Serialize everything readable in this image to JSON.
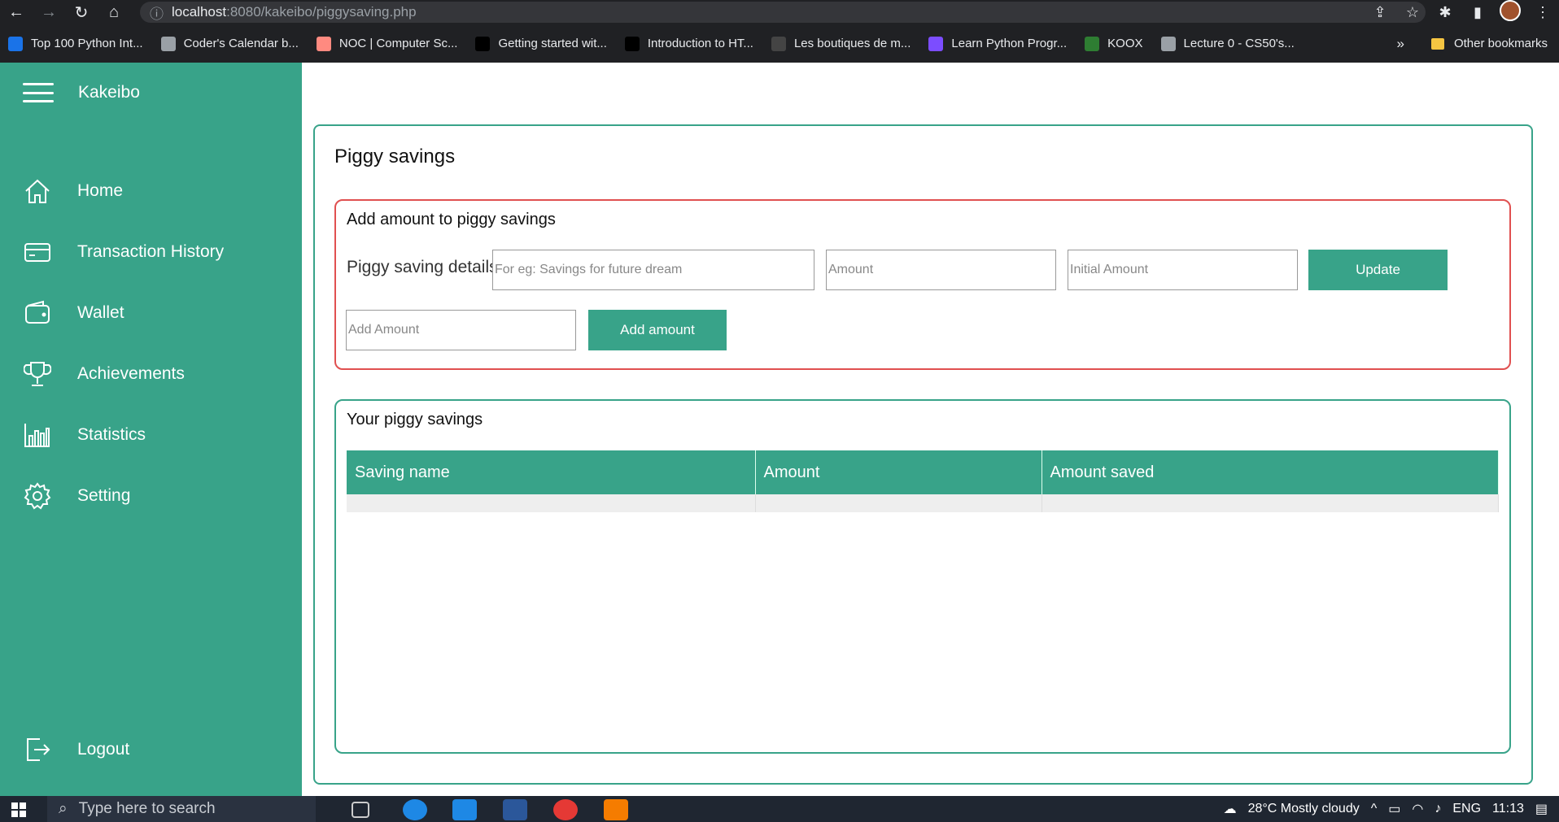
{
  "browser": {
    "url_host": "localhost",
    "url_path": ":8080/kakeibo/piggysaving.php",
    "bookmarks": [
      {
        "label": "Top 100 Python Int...",
        "color": "#1a73e8"
      },
      {
        "label": "Coder's Calendar b...",
        "color": "#9aa0a6"
      },
      {
        "label": "NOC | Computer Sc...",
        "color": "#ff8a80"
      },
      {
        "label": "Getting started wit...",
        "color": "#000000"
      },
      {
        "label": "Introduction to HT...",
        "color": "#000000"
      },
      {
        "label": "Les boutiques de m...",
        "color": "#444444"
      },
      {
        "label": "Learn Python Progr...",
        "color": "#7c4dff"
      },
      {
        "label": "KOOX",
        "color": "#2e7d32"
      },
      {
        "label": "Lecture 0 - CS50's...",
        "color": "#9aa0a6"
      }
    ],
    "more": "»",
    "other_bookmarks": "Other bookmarks"
  },
  "sidebar": {
    "brand": "Kakeibo",
    "items": [
      {
        "label": "Home",
        "icon": "home-icon"
      },
      {
        "label": "Transaction History",
        "icon": "card-icon"
      },
      {
        "label": "Wallet",
        "icon": "wallet-icon"
      },
      {
        "label": "Achievements",
        "icon": "trophy-icon"
      },
      {
        "label": "Statistics",
        "icon": "bar-chart-icon"
      },
      {
        "label": "Setting",
        "icon": "gear-icon"
      }
    ],
    "logout": "Logout"
  },
  "main": {
    "title": "Piggy savings",
    "add_section": {
      "title": "Add amount to piggy savings",
      "details_label": "Piggy saving details",
      "name_placeholder": "For eg: Savings for future dream",
      "amount_placeholder": "Amount",
      "initial_placeholder": "Initial Amount",
      "update_button": "Update",
      "add_amount_placeholder": "Add Amount",
      "add_amount_button": "Add amount"
    },
    "list_section": {
      "title": "Your piggy savings",
      "columns": [
        "Saving name",
        "Amount",
        "Amount saved"
      ]
    }
  },
  "taskbar": {
    "search_placeholder": "Type here to search",
    "weather": "28°C  Mostly cloudy",
    "lang": "ENG",
    "time": "11:13"
  },
  "colors": {
    "accent": "#38a389",
    "error_border": "#e05050"
  }
}
